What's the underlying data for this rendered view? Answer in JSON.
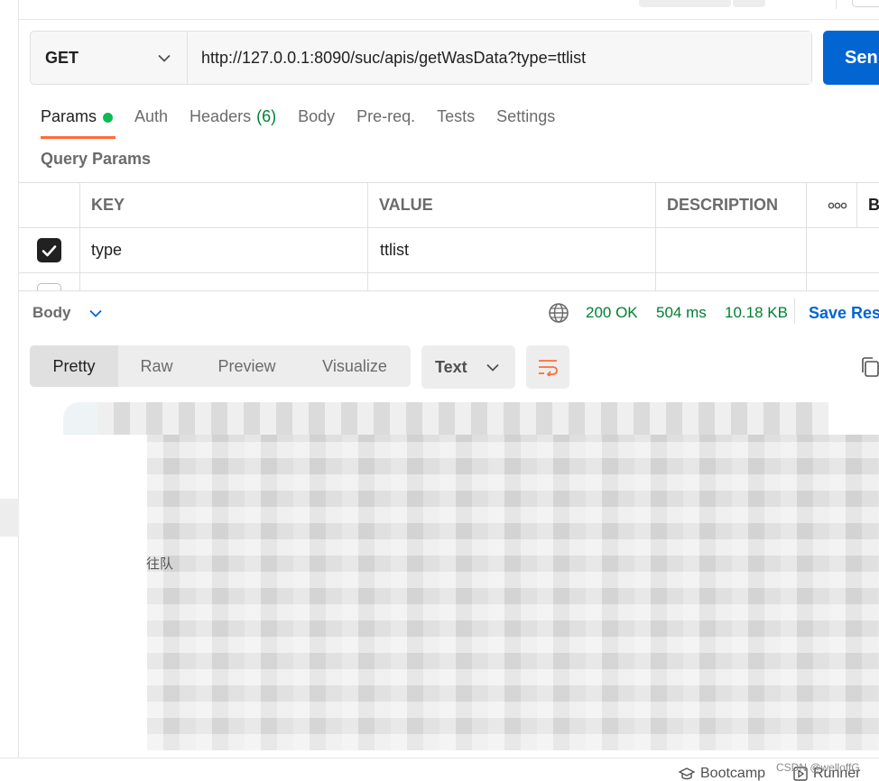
{
  "request": {
    "method": "GET",
    "url": "http://127.0.0.1:8090/suc/apis/getWasData?type=ttlist",
    "send_label": "Sen"
  },
  "tabs": [
    {
      "label": "Params"
    },
    {
      "label": "Auth"
    },
    {
      "label": "Headers",
      "count": "(6)"
    },
    {
      "label": "Body"
    },
    {
      "label": "Pre-req."
    },
    {
      "label": "Tests"
    },
    {
      "label": "Settings"
    }
  ],
  "query_params": {
    "title": "Query Params",
    "columns": [
      "KEY",
      "VALUE",
      "DESCRIPTION",
      "B"
    ],
    "rows": [
      {
        "checked": true,
        "key": "type",
        "value": "ttlist",
        "description": ""
      }
    ]
  },
  "response": {
    "body_label": "Body",
    "status": "200 OK",
    "time": "504 ms",
    "size": "10.18 KB",
    "save_label": "Save Res",
    "views": [
      "Pretty",
      "Raw",
      "Preview",
      "Visualize"
    ],
    "format": "Text"
  },
  "ghost_text": [
    "往队"
  ],
  "statusbar": {
    "bootcamp": "Bootcamp",
    "runner": "Runner",
    "watermark": "CSDN @welloffG"
  },
  "colors": {
    "accent": "#ff6c37",
    "send": "#0265d2",
    "ok": "#007f31",
    "dot": "#0cbb52"
  }
}
